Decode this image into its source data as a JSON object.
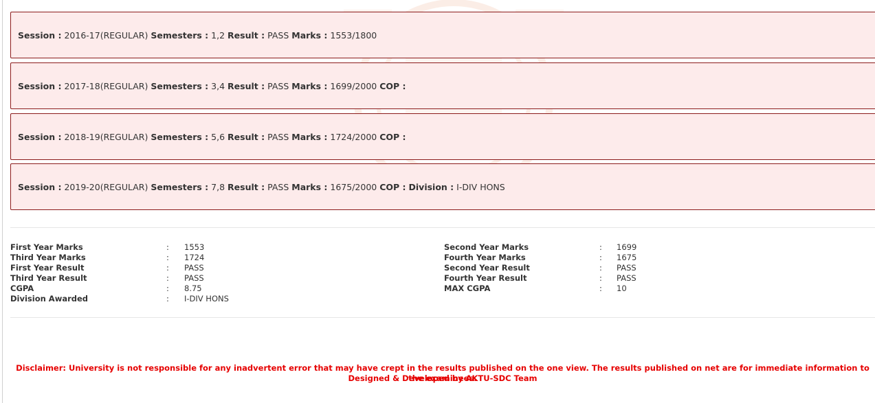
{
  "sessions": [
    {
      "session_label": "Session :",
      "session": "2016-17(REGULAR)",
      "semesters_label": "Semesters :",
      "semesters": "1,2",
      "result_label": "Result :",
      "result": "PASS",
      "marks_label": "Marks :",
      "marks": "1553/1800"
    },
    {
      "session_label": "Session :",
      "session": "2017-18(REGULAR)",
      "semesters_label": "Semesters :",
      "semesters": "3,4",
      "result_label": "Result :",
      "result": "PASS",
      "marks_label": "Marks :",
      "marks": "1699/2000",
      "cop_label": "COP :"
    },
    {
      "session_label": "Session :",
      "session": "2018-19(REGULAR)",
      "semesters_label": "Semesters :",
      "semesters": "5,6",
      "result_label": "Result :",
      "result": "PASS",
      "marks_label": "Marks :",
      "marks": "1724/2000",
      "cop_label": "COP :"
    },
    {
      "session_label": "Session :",
      "session": "2019-20(REGULAR)",
      "semesters_label": "Semesters :",
      "semesters": "7,8",
      "result_label": "Result :",
      "result": "PASS",
      "marks_label": "Marks :",
      "marks": "1675/2000",
      "cop_label": "COP :",
      "division_label": "Division :",
      "division": "I-DIV HONS"
    }
  ],
  "summary": {
    "left": [
      {
        "label": "First Year Marks",
        "sep": ":",
        "value": "1553"
      },
      {
        "label": "Third Year Marks",
        "sep": ":",
        "value": "1724"
      },
      {
        "label": "First Year Result",
        "sep": ":",
        "value": "PASS"
      },
      {
        "label": "Third Year Result",
        "sep": ":",
        "value": "PASS"
      },
      {
        "label": "CGPA",
        "sep": ":",
        "value": "8.75"
      },
      {
        "label": "Division Awarded",
        "sep": ":",
        "value": "I-DIV HONS"
      }
    ],
    "right": [
      {
        "label": "Second Year Marks",
        "sep": ":",
        "value": "1699"
      },
      {
        "label": "Fourth Year Marks",
        "sep": ":",
        "value": "1675"
      },
      {
        "label": "Second Year Result",
        "sep": ":",
        "value": "PASS"
      },
      {
        "label": "Fourth Year Result",
        "sep": ":",
        "value": "PASS"
      },
      {
        "label": "MAX CGPA",
        "sep": ":",
        "value": "10"
      }
    ]
  },
  "footer": {
    "disclaimer": "Disclaimer: University is not responsible for any inadvertent error that may have crept in the results published on the one view. The results published on net are for immediate information to the examinees.",
    "credit": "Designed & Developed by AKTU-SDC Team"
  },
  "colors": {
    "box_background": "#fdebeb",
    "box_border": "#8b1a1a",
    "disclaimer": "#e60000",
    "watermark": "#e05a1a"
  }
}
